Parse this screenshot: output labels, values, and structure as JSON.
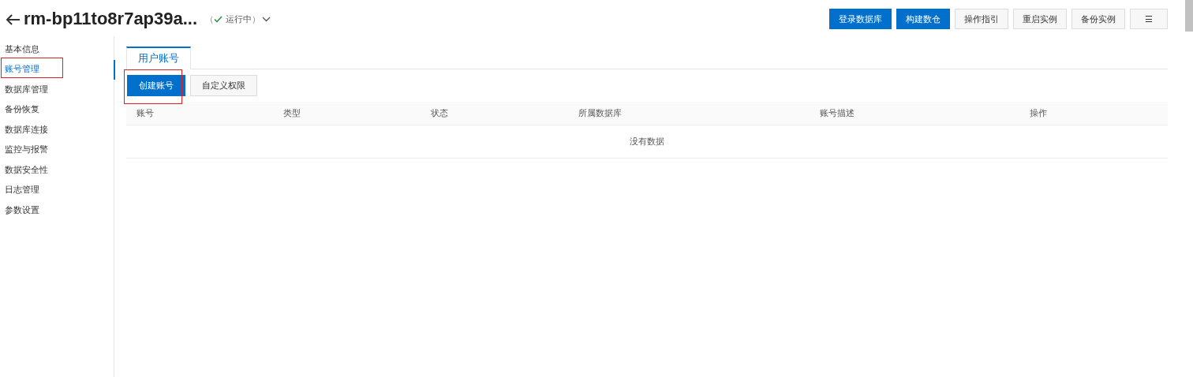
{
  "header": {
    "title": "rm-bp11to8r7ap39a...",
    "status_open": "（",
    "status": "运行中",
    "status_close": "）",
    "buttons": [
      {
        "label": "登录数据库",
        "kind": "primary"
      },
      {
        "label": "构建数仓",
        "kind": "primary"
      },
      {
        "label": "操作指引",
        "kind": "default"
      },
      {
        "label": "重启实例",
        "kind": "default"
      },
      {
        "label": "备份实例",
        "kind": "default"
      },
      {
        "label": "☰",
        "kind": "default"
      }
    ]
  },
  "sidebar": {
    "items": [
      {
        "label": "基本信息",
        "selected": false,
        "highlighted": false
      },
      {
        "label": "账号管理",
        "selected": true,
        "highlighted": true
      },
      {
        "label": "数据库管理",
        "selected": false,
        "highlighted": false
      },
      {
        "label": "备份恢复",
        "selected": false,
        "highlighted": false
      },
      {
        "label": "数据库连接",
        "selected": false,
        "highlighted": false
      },
      {
        "label": "监控与报警",
        "selected": false,
        "highlighted": false
      },
      {
        "label": "数据安全性",
        "selected": false,
        "highlighted": false
      },
      {
        "label": "日志管理",
        "selected": false,
        "highlighted": false
      },
      {
        "label": "参数设置",
        "selected": false,
        "highlighted": false
      }
    ]
  },
  "tabs": [
    {
      "label": "用户账号",
      "selected": true
    }
  ],
  "actions": [
    {
      "label": "创建账号",
      "kind": "primary",
      "highlighted": true
    },
    {
      "label": "自定义权限",
      "kind": "default",
      "highlighted": false
    }
  ],
  "table": {
    "columns": [
      "账号",
      "类型",
      "状态",
      "所属数据库",
      "账号描述",
      "操作"
    ],
    "empty_text": "没有数据"
  }
}
